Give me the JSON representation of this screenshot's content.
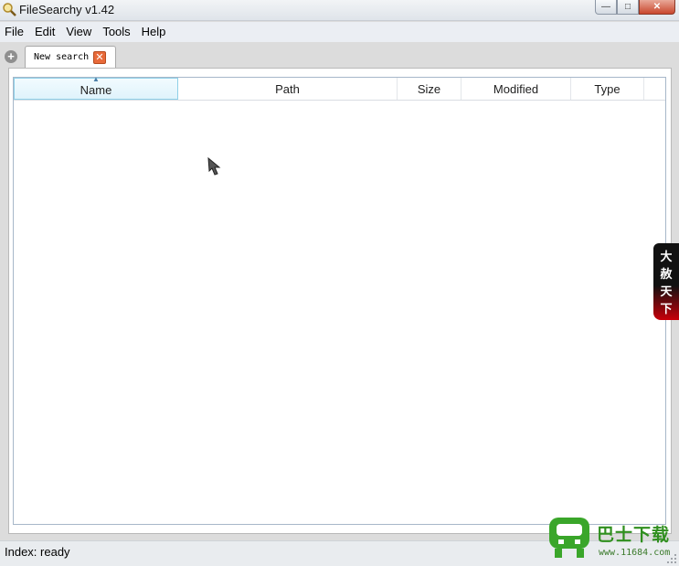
{
  "window": {
    "title": "FileSearchy v1.42",
    "controls": {
      "minimize": "—",
      "maximize": "□",
      "close": "✕"
    }
  },
  "menu": {
    "items": [
      {
        "label": "File"
      },
      {
        "label": "Edit"
      },
      {
        "label": "View"
      },
      {
        "label": "Tools"
      },
      {
        "label": "Help"
      }
    ]
  },
  "tabs": {
    "new_tab_symbol": "+",
    "items": [
      {
        "label": "New search",
        "close_symbol": "✕"
      }
    ]
  },
  "results": {
    "columns": [
      "Name",
      "Path",
      "Size",
      "Modified",
      "Type"
    ],
    "sorted_column": "Name",
    "rows": []
  },
  "status": {
    "text": "Index: ready"
  },
  "banner": {
    "chars": [
      "大",
      "赦",
      "天",
      "下"
    ]
  },
  "watermark": {
    "text": "巴士下载",
    "url": "www.11684.com"
  },
  "colors": {
    "tab_close": "#e86a3a",
    "banner_red": "#c8000a",
    "watermark_green": "#2f8f1e"
  }
}
